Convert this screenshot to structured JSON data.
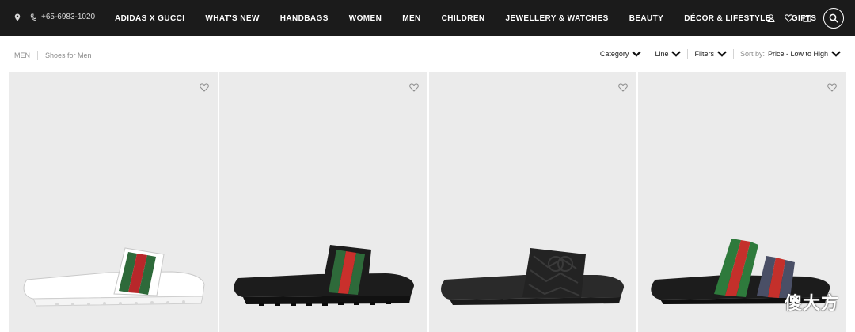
{
  "header": {
    "phone": "+65-6983-1020",
    "nav": [
      {
        "label": "ADIDAS X GUCCI"
      },
      {
        "label": "WHAT'S NEW"
      },
      {
        "label": "HANDBAGS"
      },
      {
        "label": "WOMEN"
      },
      {
        "label": "MEN"
      },
      {
        "label": "CHILDREN"
      },
      {
        "label": "JEWELLERY & WATCHES"
      },
      {
        "label": "BEAUTY"
      },
      {
        "label": "DÉCOR & LIFESTYLE"
      },
      {
        "label": "GIFTS"
      }
    ],
    "icons": [
      "account-icon",
      "heart-icon",
      "shopping-bag-icon",
      "search-icon"
    ]
  },
  "breadcrumb": {
    "items": [
      {
        "label": "MEN"
      },
      {
        "label": "Shoes for Men"
      }
    ]
  },
  "filters": {
    "category": "Category",
    "line": "Line",
    "filters": "Filters",
    "sort_label": "Sort by:",
    "sort_value": "Price - Low to High"
  },
  "products": [
    {
      "name": "white-slide-web-stripe",
      "sole_color": "#ffffff",
      "stripes": [
        "#2e6a3a",
        "#b8272a",
        "#2e6a3a"
      ]
    },
    {
      "name": "black-slide-web-stripe",
      "sole_color": "#1c1c1c",
      "stripes": [
        "#2e6a3a",
        "#c9302c",
        "#2e6a3a"
      ]
    },
    {
      "name": "black-gg-slide",
      "sole_color": "#232323",
      "stripes": []
    },
    {
      "name": "black-slide-multi-stripe",
      "sole_color": "#1c1c1c",
      "stripes": [
        "#2e7a3c",
        "#c4302b",
        "#2e7a3c",
        "#c4302b",
        "#4a4f66"
      ]
    }
  ],
  "watermark": "傻大方"
}
